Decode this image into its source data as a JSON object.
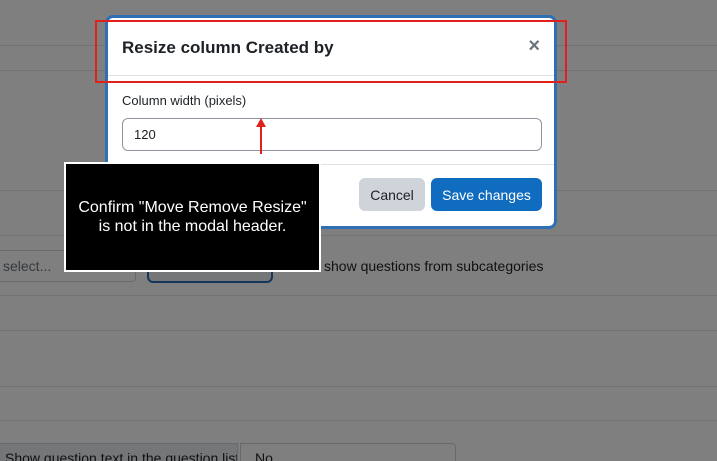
{
  "modal": {
    "title": "Resize column Created by",
    "close_glyph": "×",
    "field_label": "Column width (pixels)",
    "width_value": "120",
    "cancel_label": "Cancel",
    "save_label": "Save changes"
  },
  "background": {
    "select_placeholder": "select...",
    "subcategories_label": "show questions from subcategories",
    "question_text_label": "Show question text in the question list?",
    "question_text_value": "No"
  },
  "annotation": {
    "callout_text": "Confirm \"Move Remove Resize\" is not in the modal header.",
    "highlight_color": "#e0201c"
  },
  "colors": {
    "primary": "#0f6cbf",
    "modal_border": "#2f6fb6"
  }
}
